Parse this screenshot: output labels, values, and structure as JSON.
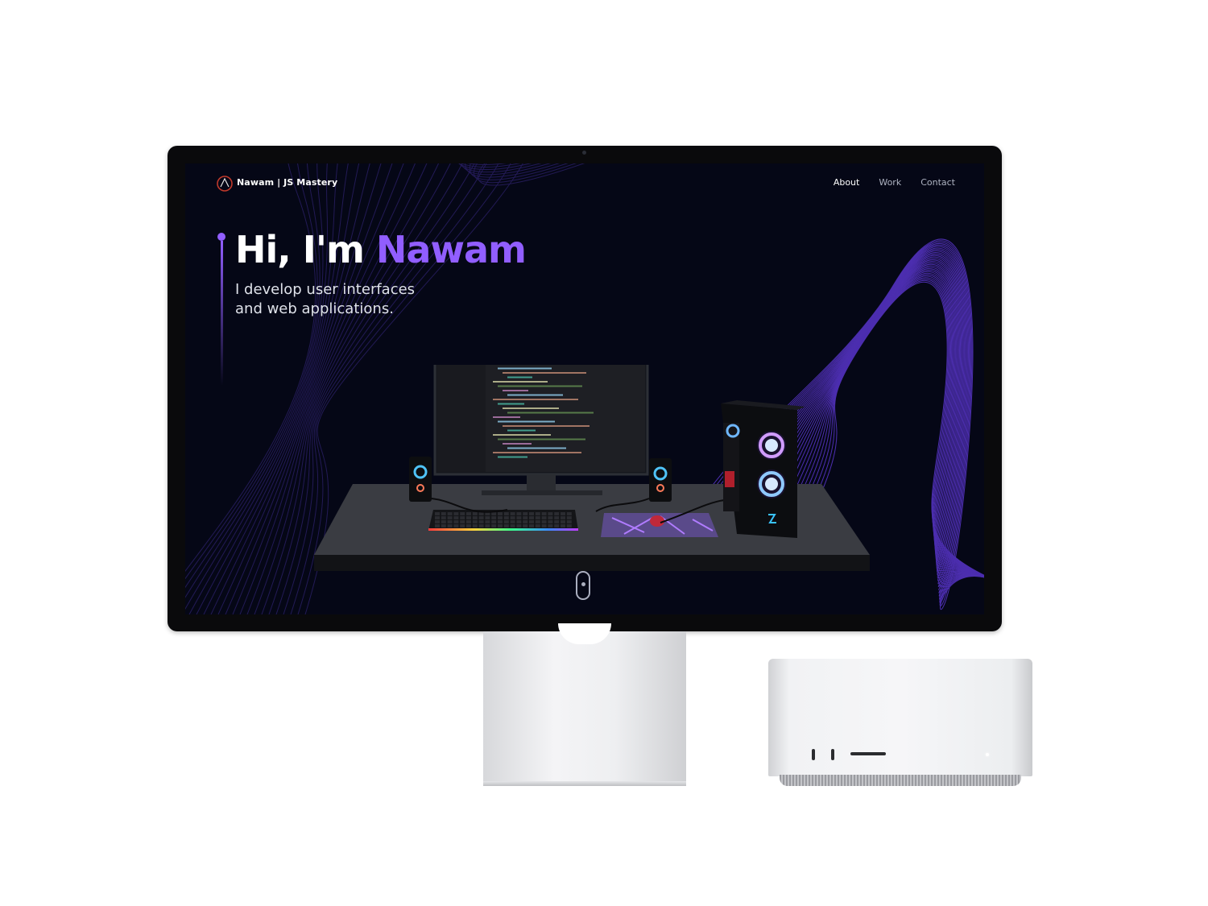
{
  "site": {
    "brand": "Nawam | JS Mastery",
    "nav": [
      {
        "label": "About"
      },
      {
        "label": "Work"
      },
      {
        "label": "Contact"
      }
    ]
  },
  "hero": {
    "greeting": "Hi, I'm ",
    "name": "Nawam",
    "subtitle_line1": "I develop user interfaces",
    "subtitle_line2": "and web applications."
  },
  "colors": {
    "accent": "#915eff",
    "screen_bg": "#050716",
    "text_primary": "#ffffff",
    "nav_inactive": "#aeb3c2"
  },
  "icons": {
    "logo": "logo-icon",
    "scroll": "scroll-down-icon"
  }
}
